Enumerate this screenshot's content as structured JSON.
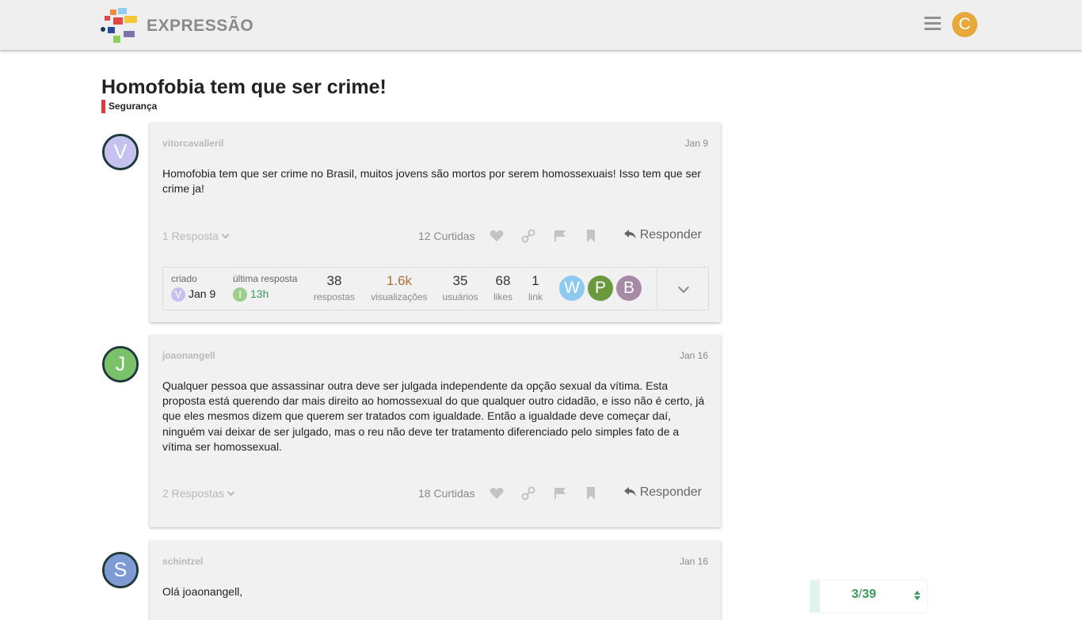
{
  "header": {
    "brand": "EXPRESSÃO",
    "user_initial": "C",
    "user_color": "#e8a93c",
    "menu_icon": "hamburger-icon"
  },
  "topic": {
    "title": "Homofobia tem que ser crime!",
    "category": "Segurança",
    "category_color": "#e03b3b"
  },
  "posts": [
    {
      "username": "vitorcavalleril",
      "initial": "V",
      "avatar_color": "#c5c2f0",
      "date": "Jan 9",
      "body": "Homofobia tem que ser crime no Brasil, muitos jovens são mortos por serem homossexuais! Isso tem que ser crime ja!",
      "replies": "1 Resposta",
      "likes": "12 Curtidas",
      "reply_label": "Responder"
    },
    {
      "username": "joaonangell",
      "initial": "J",
      "avatar_color": "#7ac16a",
      "date": "Jan 16",
      "body": "Qualquer pessoa que assassinar outra deve ser julgada independente da opção sexual da vítima. Esta proposta está querendo dar mais direito ao homossexual do que qualquer outro cidadão, e isso não é certo, já que eles mesmos dizem que querem ser tratados com igualdade. Então a igualdade deve começar daí, ninguém vai deixar de ser julgado, mas o reu não deve ter tratamento diferenciado pelo simples fato de a vítima ser homossexual.",
      "replies": "2 Respostas",
      "likes": "18 Curtidas",
      "reply_label": "Responder"
    },
    {
      "username": "schintzel",
      "initial": "S",
      "avatar_color": "#7f9bd6",
      "date": "Jan 16",
      "body": "Olá joaonangell,"
    }
  ],
  "topic_map": {
    "created_label": "criado",
    "created_initial": "V",
    "created_color": "#c5c2f0",
    "created_date": "Jan 9",
    "last_reply_label": "última resposta",
    "last_reply_initial": "I",
    "last_reply_color": "#9ccf8c",
    "last_reply_time": "13h",
    "stats": [
      {
        "value": "38",
        "label": "respostas"
      },
      {
        "value": "1.6k",
        "label": "visualizações"
      },
      {
        "value": "35",
        "label": "usuários"
      },
      {
        "value": "68",
        "label": "likes"
      },
      {
        "value": "1",
        "label": "link"
      }
    ],
    "participants": [
      {
        "initial": "W",
        "color": "#8ec9ef"
      },
      {
        "initial": "P",
        "color": "#6a9a3d"
      },
      {
        "initial": "B",
        "color": "#a68aa6"
      }
    ]
  },
  "timeline": {
    "current": "3",
    "separator": "/",
    "total": "39"
  }
}
